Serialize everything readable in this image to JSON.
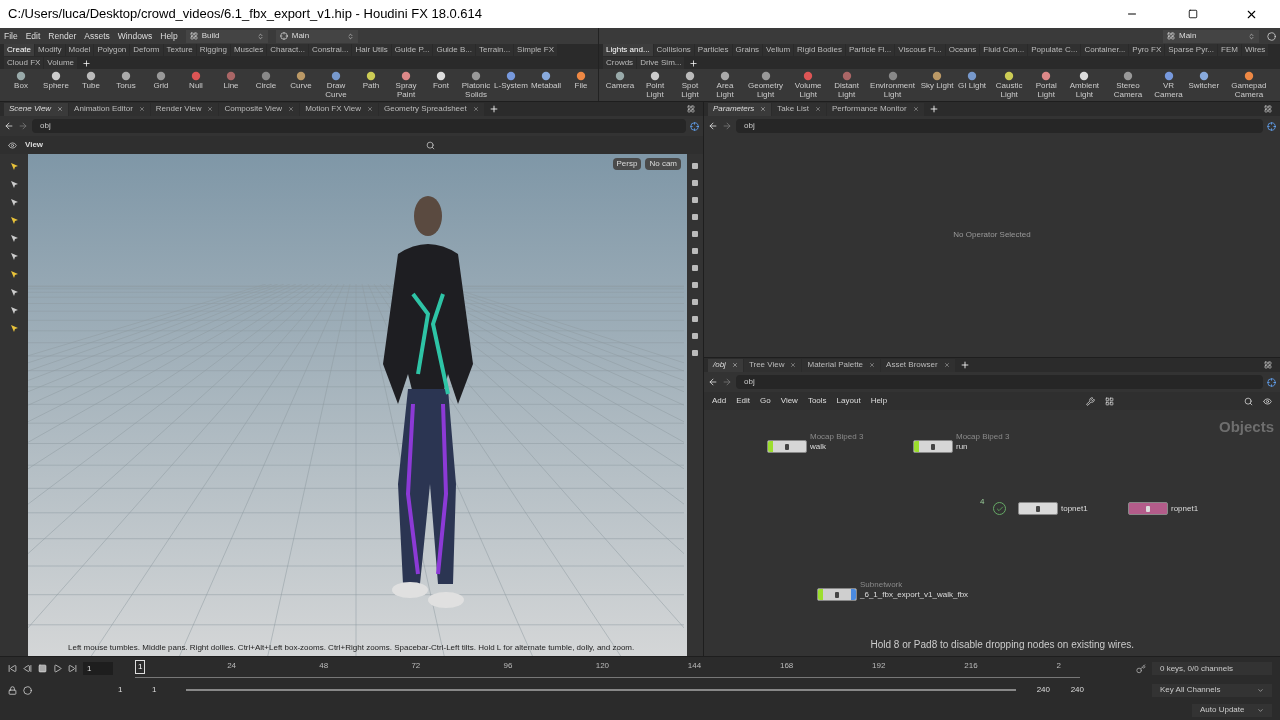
{
  "window": {
    "title": "C:/Users/luca/Desktop/crowd_videos/6.1_fbx_export_v1.hip - Houdini FX 18.0.614"
  },
  "menu": [
    "File",
    "Edit",
    "Render",
    "Assets",
    "Windows",
    "Help"
  ],
  "desktop_dropdown": "Build",
  "context_dropdown": "Main",
  "right_context_dropdown": "Main",
  "shelf_left": {
    "tabs": [
      {
        "label": "Create",
        "selected": true
      },
      {
        "label": "Modify",
        "selected": false
      },
      {
        "label": "Model",
        "selected": false
      },
      {
        "label": "Polygon",
        "selected": false
      },
      {
        "label": "Deform",
        "selected": false
      },
      {
        "label": "Texture",
        "selected": false
      },
      {
        "label": "Rigging",
        "selected": false
      },
      {
        "label": "Muscles",
        "selected": false
      },
      {
        "label": "Charact...",
        "selected": false
      },
      {
        "label": "Constrai...",
        "selected": false
      },
      {
        "label": "Hair Utils",
        "selected": false
      },
      {
        "label": "Guide P...",
        "selected": false
      },
      {
        "label": "Guide B...",
        "selected": false
      },
      {
        "label": "Terrain...",
        "selected": false
      },
      {
        "label": "Simple FX",
        "selected": false
      },
      {
        "label": "Cloud FX",
        "selected": false
      },
      {
        "label": "Volume",
        "selected": false
      }
    ],
    "tools": [
      "Box",
      "Sphere",
      "Tube",
      "Torus",
      "Grid",
      "Null",
      "Line",
      "Circle",
      "Curve",
      "Draw Curve",
      "Path",
      "Spray Paint",
      "Font",
      "Platonic Solids",
      "L-System",
      "Metaball",
      "File"
    ]
  },
  "shelf_right": {
    "tabs": [
      {
        "label": "Lights and...",
        "selected": true
      },
      {
        "label": "Collisions",
        "selected": false
      },
      {
        "label": "Particles",
        "selected": false
      },
      {
        "label": "Grains",
        "selected": false
      },
      {
        "label": "Vellum",
        "selected": false
      },
      {
        "label": "Rigid Bodies",
        "selected": false
      },
      {
        "label": "Particle Fl...",
        "selected": false
      },
      {
        "label": "Viscous Fl...",
        "selected": false
      },
      {
        "label": "Oceans",
        "selected": false
      },
      {
        "label": "Fluid Con...",
        "selected": false
      },
      {
        "label": "Populate C...",
        "selected": false
      },
      {
        "label": "Container...",
        "selected": false
      },
      {
        "label": "Pyro FX",
        "selected": false
      },
      {
        "label": "Sparse Pyr...",
        "selected": false
      },
      {
        "label": "FEM",
        "selected": false
      },
      {
        "label": "Wires",
        "selected": false
      },
      {
        "label": "Crowds",
        "selected": false
      },
      {
        "label": "Drive Sim...",
        "selected": false
      }
    ],
    "tools": [
      "Camera",
      "Point Light",
      "Spot Light",
      "Area Light",
      "Geometry Light",
      "Volume Light",
      "Distant Light",
      "Environment Light",
      "Sky Light",
      "GI Light",
      "Caustic Light",
      "Portal Light",
      "Ambient Light",
      "Stereo Camera",
      "VR Camera",
      "Switcher",
      "Gamepad Camera"
    ]
  },
  "scene_pane": {
    "tabs": [
      {
        "label": "Scene View",
        "selected": true
      },
      {
        "label": "Animation Editor",
        "selected": false
      },
      {
        "label": "Render View",
        "selected": false
      },
      {
        "label": "Composite View",
        "selected": false
      },
      {
        "label": "Motion FX View",
        "selected": false
      },
      {
        "label": "Geometry Spreadsheet",
        "selected": false
      }
    ],
    "path": "obj",
    "toolbar_title": "View",
    "camera_buttons": [
      "Persp",
      "No cam"
    ],
    "hint": "Left mouse tumbles. Middle pans. Right dollies. Ctrl+Alt+Left box-zooms. Ctrl+Right zooms. Spacebar-Ctrl-Left tilts. Hold L for alternate tumble, dolly, and zoom."
  },
  "parameters_pane": {
    "tabs": [
      {
        "label": "Parameters",
        "selected": true
      },
      {
        "label": "Take List",
        "selected": false
      },
      {
        "label": "Performance Monitor",
        "selected": false
      }
    ],
    "path": "obj",
    "message": "No Operator Selected"
  },
  "network_pane": {
    "tabs": [
      {
        "label": "/obj",
        "selected": true
      },
      {
        "label": "Tree View",
        "selected": false
      },
      {
        "label": "Material Palette",
        "selected": false
      },
      {
        "label": "Asset Browser",
        "selected": false
      }
    ],
    "path": "obj",
    "menu": [
      "Add",
      "Edit",
      "Go",
      "View",
      "Tools",
      "Layout",
      "Help"
    ],
    "context_label": "Objects",
    "nodes": [
      {
        "name": "walk",
        "type": "Mocap Biped 3",
        "kind": "biped"
      },
      {
        "name": "run",
        "type": "Mocap Biped 3",
        "kind": "biped"
      },
      {
        "name": "topnet1",
        "kind": "topnet"
      },
      {
        "name": "ropnet1",
        "kind": "ropnet"
      },
      {
        "name": "_6_1_fbx_export_v1_walk_fbx",
        "type": "Subnetwork",
        "kind": "subnet"
      }
    ],
    "badge": "4",
    "hint": "Hold 8 or Pad8 to disable dropping nodes on existing wires."
  },
  "timeline": {
    "frame": "1",
    "marker": "1",
    "ruler_labels": [
      "24",
      "48",
      "72",
      "96",
      "120",
      "144",
      "168",
      "192",
      "216",
      "2"
    ],
    "range_start": "1",
    "range_current": "1",
    "range_end": "240",
    "range_total": "240",
    "keys_info": "0 keys, 0/0 channels",
    "key_button": "Key All Channels",
    "update_mode": "Auto Update"
  }
}
